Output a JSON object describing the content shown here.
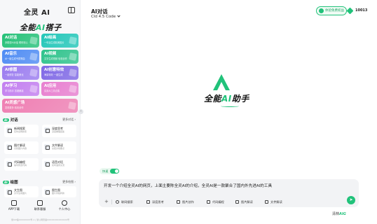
{
  "sidebar": {
    "brand": "全灵 AI",
    "logo": {
      "prefix": "全能",
      "ai": "AI",
      "suffix": "搭子"
    },
    "tiles": [
      {
        "title": "AI对话",
        "desc": "多模型AI对话 聪明省心",
        "color": "#25c178"
      },
      {
        "title": "AI绘画",
        "desc": "一句话生成精美图片",
        "color": "#23c7b9"
      },
      {
        "title": "AI音乐",
        "desc": "AI一键生成专属歌曲",
        "color": "#4f8cf4"
      },
      {
        "title": "AI视频",
        "desc": "文字生成视频 轻松创作",
        "color": "#2fc38c"
      },
      {
        "title": "AI修图",
        "desc": "一键修复 智能美化",
        "color": "#9b7cf0"
      },
      {
        "title": "AI创意特效",
        "desc": "海量特效 一键生成",
        "color": "#8069e6"
      },
      {
        "title": "AI学习",
        "desc": "学习助手 答疑解惑",
        "color": "#c37ff0"
      },
      {
        "title": "AI应用",
        "desc": "实用AI工具合集",
        "color": "#e87fd0"
      },
      {
        "title": "AI灵感广场",
        "desc": "发现更多 精彩创作",
        "color": "#ef7fb3"
      }
    ],
    "chat_section": {
      "badge": "AI",
      "title": "对话",
      "more": "更多对话 ›"
    },
    "chat_items": [
      {
        "title": "新闻搜索",
        "desc": "实时全网搜索"
      },
      {
        "title": "深度思考",
        "desc": "深度推理回答"
      },
      {
        "title": "图片解读",
        "desc": "识别图片内容"
      },
      {
        "title": "文件解读",
        "desc": "总结文档要点"
      },
      {
        "title": "代码编程",
        "desc": "编写修改代码"
      },
      {
        "title": "语音对话",
        "desc": "实时语音交流"
      }
    ],
    "draw_section": {
      "badge": "AI",
      "title": "绘图",
      "more": "更多绘图 ›"
    },
    "draw_items": [
      {
        "title": "文生图",
        "desc": "文字生成图片"
      },
      {
        "title": "图生图",
        "desc": "图片风格转换"
      }
    ],
    "bottom_nav": [
      {
        "label": "APP下载",
        "icon": "phone-icon"
      },
      {
        "label": "联系客服",
        "icon": "headset-icon"
      },
      {
        "label": "个人中心",
        "icon": "user-icon"
      }
    ],
    "footer": "浙ICP备XXXXXXXX号-1 | 浙公网安备XXXXXXXXXXXXXX号"
  },
  "header": {
    "title": "AI对话",
    "model": "Cld 4.5 Code",
    "free_badge": "体验免费权益",
    "points": "10013"
  },
  "center": {
    "prefix": "全能",
    "ai": "AI",
    "suffix": "助手"
  },
  "composer": {
    "toggle_label": "快速",
    "input_value": "开发一个介绍全灵AI的网页，上面主要陈全灵AI的介绍，全灵AI是一款聚合了国内外先进AI的工具",
    "tools": [
      "联网搜索",
      "深度思考",
      "图片创作",
      "代码编程",
      "图片解读",
      "文件解读"
    ],
    "send_icon": "arrow-up-icon"
  },
  "corner_brand": {
    "prefix": "清林",
    "suffix": "AIG"
  },
  "colors": {
    "accent": "#21c27a",
    "sidebar_bg": "#f6f7f9",
    "composer_bg": "#f2f3f5"
  }
}
